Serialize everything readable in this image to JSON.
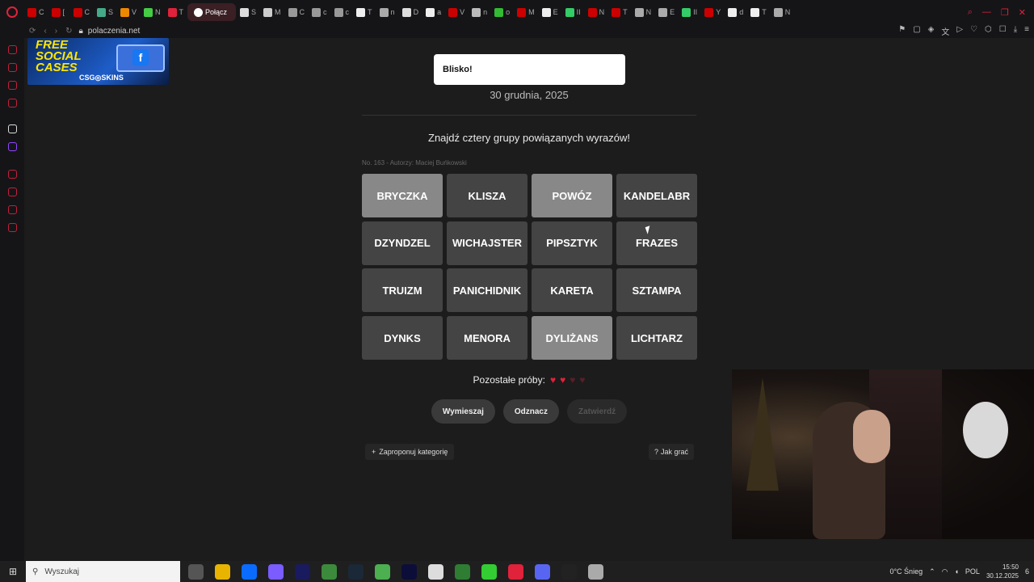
{
  "browser": {
    "active_tab_label": "Połącz",
    "tab_letters": [
      "C",
      "[",
      "C",
      "S",
      "V",
      "N",
      "T",
      "S",
      "M",
      "C",
      "c",
      "c",
      "T",
      "n",
      "D",
      "a",
      "V",
      "n",
      "o",
      "M",
      "E",
      "II",
      "N",
      "T",
      "N",
      "E",
      "II",
      "Y",
      "d",
      "T",
      "N"
    ],
    "url": "polaczenia.net"
  },
  "ad": {
    "line1": "FREE",
    "line2": "SOCIAL",
    "line3": "CASES",
    "brand": "CSG◎SKINS",
    "fb": "f"
  },
  "toast": {
    "text": "Blisko!"
  },
  "game": {
    "date": "30 grudnia, 2025",
    "subtitle": "Znajdź cztery grupy powiązanych wyrazów!",
    "meta": "No. 163 - Autorzy: Maciej Buńkowski",
    "tiles": [
      {
        "word": "BRYCZKA",
        "selected": true
      },
      {
        "word": "KLISZA",
        "selected": false
      },
      {
        "word": "POWÓZ",
        "selected": true
      },
      {
        "word": "KANDELABR",
        "selected": false
      },
      {
        "word": "DZYNDZEL",
        "selected": false
      },
      {
        "word": "WICHAJSTER",
        "selected": false
      },
      {
        "word": "PIPSZTYK",
        "selected": false
      },
      {
        "word": "FRAZES",
        "selected": false
      },
      {
        "word": "TRUIZM",
        "selected": false
      },
      {
        "word": "PANICHIDNIK",
        "selected": false
      },
      {
        "word": "KARETA",
        "selected": false
      },
      {
        "word": "SZTAMPA",
        "selected": false
      },
      {
        "word": "DYNKS",
        "selected": false
      },
      {
        "word": "MENORA",
        "selected": false
      },
      {
        "word": "DYLIŻANS",
        "selected": true
      },
      {
        "word": "LICHTARZ",
        "selected": false
      }
    ],
    "tries_label": "Pozostałe próby:",
    "hearts_remaining": 2,
    "hearts_total": 4,
    "heart_glyph": "♥",
    "buttons": {
      "shuffle": "Wymieszaj",
      "deselect": "Odznacz",
      "submit": "Zatwierdź"
    },
    "suggest_label": "Zaproponuj kategorię",
    "suggest_icon": "+",
    "howto_label": "Jak grać",
    "howto_icon": "?"
  },
  "taskbar": {
    "search_placeholder": "Wyszukaj",
    "weather": "0°C  Śnieg",
    "lang": "POL",
    "time": "15:50",
    "date": "30.12.2025",
    "notifications": "6"
  },
  "colors": {
    "accent": "#e0223b",
    "tile": "#444444",
    "tile_selected": "#888888"
  }
}
